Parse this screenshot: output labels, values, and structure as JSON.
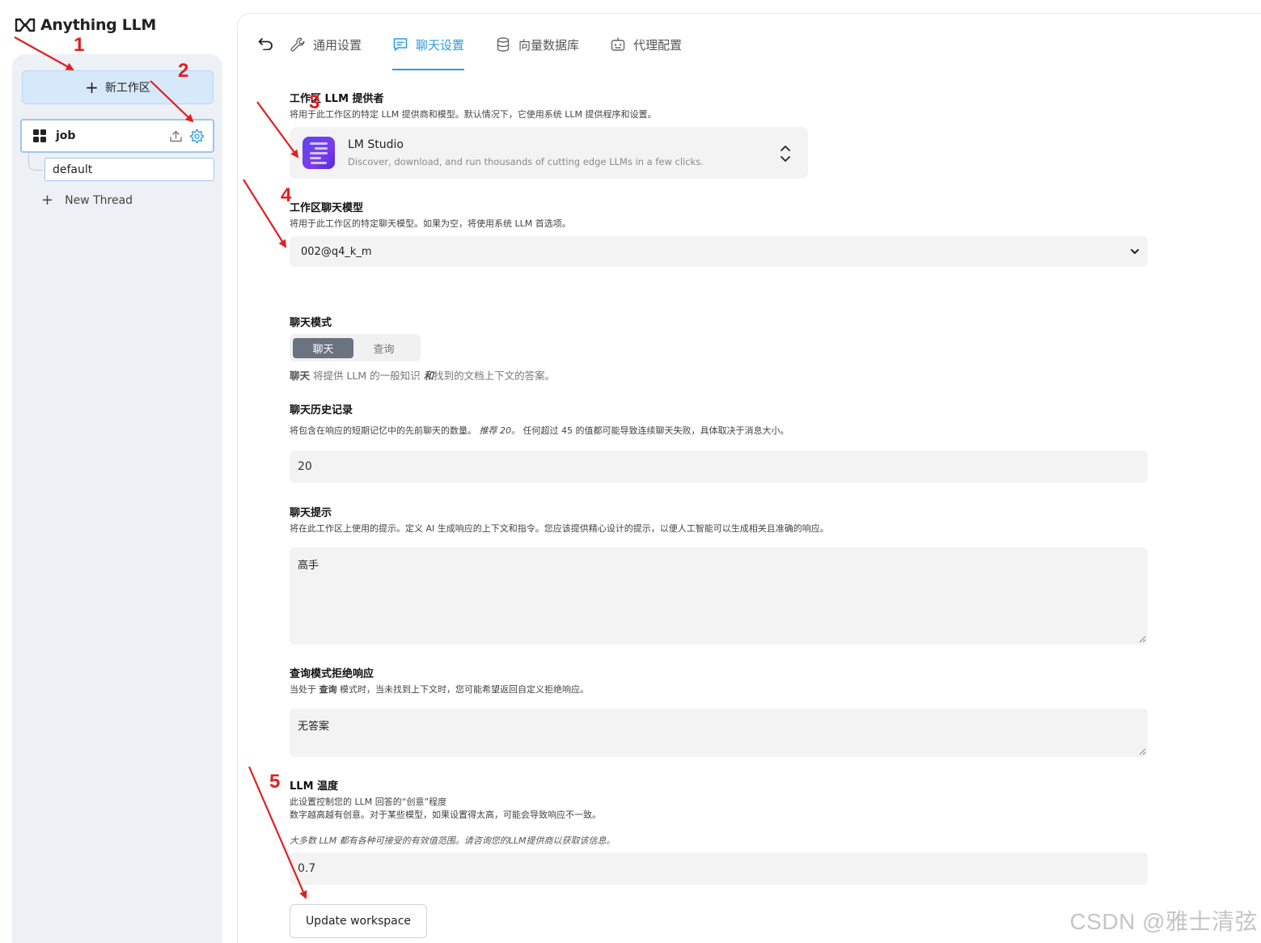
{
  "brand": {
    "name": "Anything LLM",
    "icon": "anything-llm-logo-icon"
  },
  "sidebar": {
    "new_workspace_label": "新工作区",
    "workspace": {
      "name": "job",
      "icons": [
        "upload-icon",
        "gear-icon"
      ]
    },
    "thread": {
      "name": "default"
    },
    "new_thread_label": "New Thread"
  },
  "tabs": [
    {
      "label": "通用设置",
      "icon": "wrench-icon",
      "active": false
    },
    {
      "label": "聊天设置",
      "icon": "chat-icon",
      "active": true
    },
    {
      "label": "向量数据库",
      "icon": "database-icon",
      "active": false
    },
    {
      "label": "代理配置",
      "icon": "robot-icon",
      "active": false
    }
  ],
  "llm_provider": {
    "title": "工作区 LLM 提供者",
    "desc": "将用于此工作区的特定 LLM 提供商和模型。默认情况下，它使用系统 LLM 提供程序和设置。",
    "provider_name": "LM Studio",
    "provider_desc": "Discover, download, and run thousands of cutting edge LLMs in a few clicks."
  },
  "chat_model": {
    "title": "工作区聊天模型",
    "desc": "将用于此工作区的特定聊天模型。如果为空，将使用系统 LLM 首选项。",
    "value": "002@q4_k_m"
  },
  "chat_mode": {
    "title": "聊天模式",
    "options": [
      "聊天",
      "查询"
    ],
    "selected": "聊天",
    "desc_strong": "聊天",
    "desc_middle": " 将提供 LLM 的一般知识 ",
    "desc_em": "和",
    "desc_end": "找到的文档上下文的答案。"
  },
  "chat_history": {
    "title": "聊天历史记录",
    "desc_a": "将包含在响应的短期记忆中的先前聊天的数量。",
    "desc_em": "推荐 20。",
    "desc_b": "任何超过 45 的值都可能导致连续聊天失败，具体取决于消息大小。",
    "value": "20"
  },
  "chat_prompt": {
    "title": "聊天提示",
    "desc": "将在此工作区上使用的提示。定义 AI 生成响应的上下文和指令。您应该提供精心设计的提示，以便人工智能可以生成相关且准确的响应。",
    "value": "高手"
  },
  "query_refusal": {
    "title": "查询模式拒绝响应",
    "desc_a": "当处于 ",
    "desc_strong": "查询",
    "desc_b": " 模式时，当未找到上下文时，您可能希望返回自定义拒绝响应。",
    "value": "无答案"
  },
  "temperature": {
    "title": "LLM 温度",
    "desc_1": "此设置控制您的 LLM 回答的“创意”程度",
    "desc_2": "数字越高越有创意。对于某些模型，如果设置得太高，可能会导致响应不一致。",
    "desc_3": "大多数 LLM 都有各种可接受的有效值范围。请咨询您的LLM提供商以获取该信息。",
    "value": "0.7"
  },
  "update_button": "Update workspace",
  "annotations": [
    "1",
    "2",
    "3",
    "4",
    "5"
  ],
  "annotation_color": "#e02020",
  "accent_color": "#2d9be0",
  "watermark": "CSDN @雅士清弦"
}
